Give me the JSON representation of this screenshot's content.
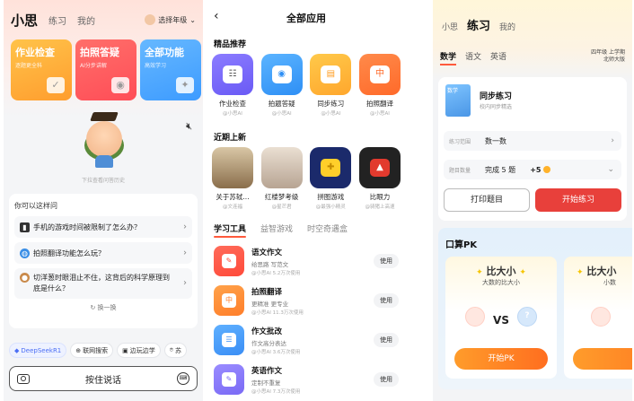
{
  "home": {
    "nav": {
      "brand": "小思",
      "tab_practice": "练习",
      "tab_mine": "我的",
      "grade_label": "选择年级"
    },
    "cards": [
      {
        "title": "作业检查",
        "subtitle": "逐题更全科"
      },
      {
        "title": "拍照答疑",
        "subtitle": "AI分步讲解"
      },
      {
        "title": "全部功能",
        "subtitle": "高效学习"
      }
    ],
    "history_hint": "下拉查看问答历史",
    "ask_header": "你可以这样问",
    "questions": [
      "手机的游戏时间被限制了怎么办？",
      "拍照翻译功能怎么玩？",
      "切洋葱时眼泪止不住，这背后的科学原理到底是什么？"
    ],
    "refresh_label": "换一换",
    "chips": [
      "DeepSeekR1",
      "联网搜索",
      "边玩边学",
      "苏"
    ],
    "talk_label": "按住说话"
  },
  "all_apps": {
    "title": "全部应用",
    "featured_header": "精品推荐",
    "featured": [
      {
        "name": "作业检查",
        "maker": "@小思AI"
      },
      {
        "name": "拍题答疑",
        "maker": "@小思AI"
      },
      {
        "name": "同步练习",
        "maker": "@小思AI"
      },
      {
        "name": "拍照翻译",
        "maker": "@小思AI"
      }
    ],
    "recent_header": "近期上新",
    "recent": [
      {
        "name": "关于苏轼...",
        "maker": "@文连福"
      },
      {
        "name": "红楼梦考级",
        "maker": "@星芒君"
      },
      {
        "name": "拼图游戏",
        "maker": "@最强小精灵"
      },
      {
        "name": "比眼力",
        "maker": "@骑猪上高速"
      }
    ],
    "tabs": [
      "学习工具",
      "益智游戏",
      "时空奇遇盒"
    ],
    "tools": [
      {
        "name": "语文作文",
        "desc": "给思路 写范文",
        "meta": "@小思AI  5.2万次使用",
        "action": "使用"
      },
      {
        "name": "拍照翻译",
        "desc": "更精准 更专业",
        "meta": "@小思AI  11.3万次使用",
        "action": "使用"
      },
      {
        "name": "作文批改",
        "desc": "作文高分表达",
        "meta": "@小思AI  3.6万次使用",
        "action": "使用"
      },
      {
        "name": "英语作文",
        "desc": "定制不重复",
        "meta": "@小思AI  7.3万次使用",
        "action": "使用"
      }
    ]
  },
  "practice": {
    "nav": {
      "tab_brand": "小思",
      "tab_practice": "练习",
      "tab_mine": "我的"
    },
    "subjects": [
      "数学",
      "语文",
      "英语"
    ],
    "term_line1": "四年级 上学期",
    "term_line2": "北师大版",
    "book_cover_text": "数学",
    "sync_title": "同步练习",
    "sync_sub": "校内同步精选",
    "range_label": "练习范围",
    "range_value": "数一数",
    "count_label": "题目数量",
    "count_value": "完成 5 题",
    "reward": "+5",
    "print_label": "打印题目",
    "start_label": "开始练习",
    "pk_header": "口算PK",
    "pk_cards": [
      {
        "name": "比大小",
        "desc": "大数的比大小",
        "vs": "VS",
        "go": "开始PK"
      },
      {
        "name": "比大小",
        "desc": "小数"
      }
    ]
  },
  "colors": {
    "accent_red": "#e8403b",
    "pk_orange": "#ff7e24",
    "deepseek_blue": "#4b6ef5"
  }
}
